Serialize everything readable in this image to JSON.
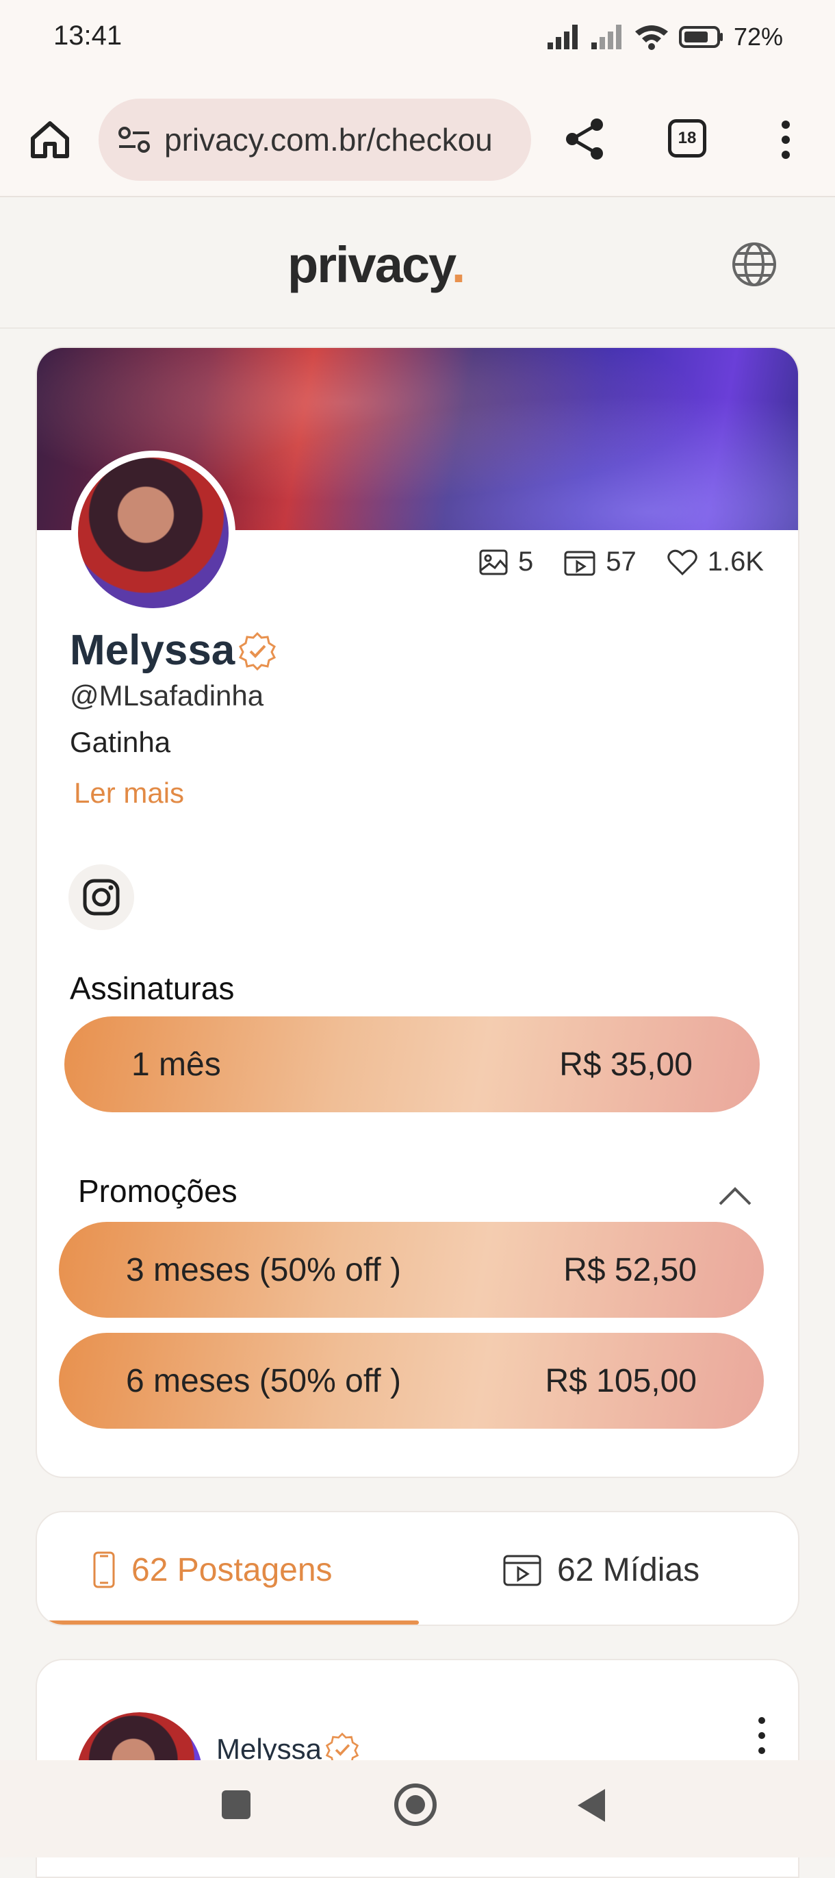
{
  "status_bar": {
    "time": "13:41",
    "battery": "72%"
  },
  "browser": {
    "url": "privacy.com.br/checkou",
    "tab_count": "18"
  },
  "header": {
    "logo_text": "privacy",
    "logo_dot": "."
  },
  "profile": {
    "stats": {
      "photos": "5",
      "videos": "57",
      "likes": "1.6K"
    },
    "name": "Melyssa",
    "handle": "@MLsafadinha",
    "bio": "Gatinha",
    "read_more": "Ler mais"
  },
  "subscriptions": {
    "title": "Assinaturas",
    "plans": [
      {
        "label": "1 mês",
        "price": "R$ 35,00"
      }
    ]
  },
  "promotions": {
    "title": "Promoções",
    "plans": [
      {
        "label": "3 meses (50% off )",
        "price": "R$ 52,50"
      },
      {
        "label": "6 meses (50% off )",
        "price": "R$ 105,00"
      }
    ]
  },
  "tabs": {
    "posts": "62 Postagens",
    "media": "62 Mídias"
  },
  "post": {
    "author": "Melyssa"
  },
  "colors": {
    "accent": "#e8914e",
    "verified": "#e8914e",
    "text_dark": "#23303f"
  }
}
